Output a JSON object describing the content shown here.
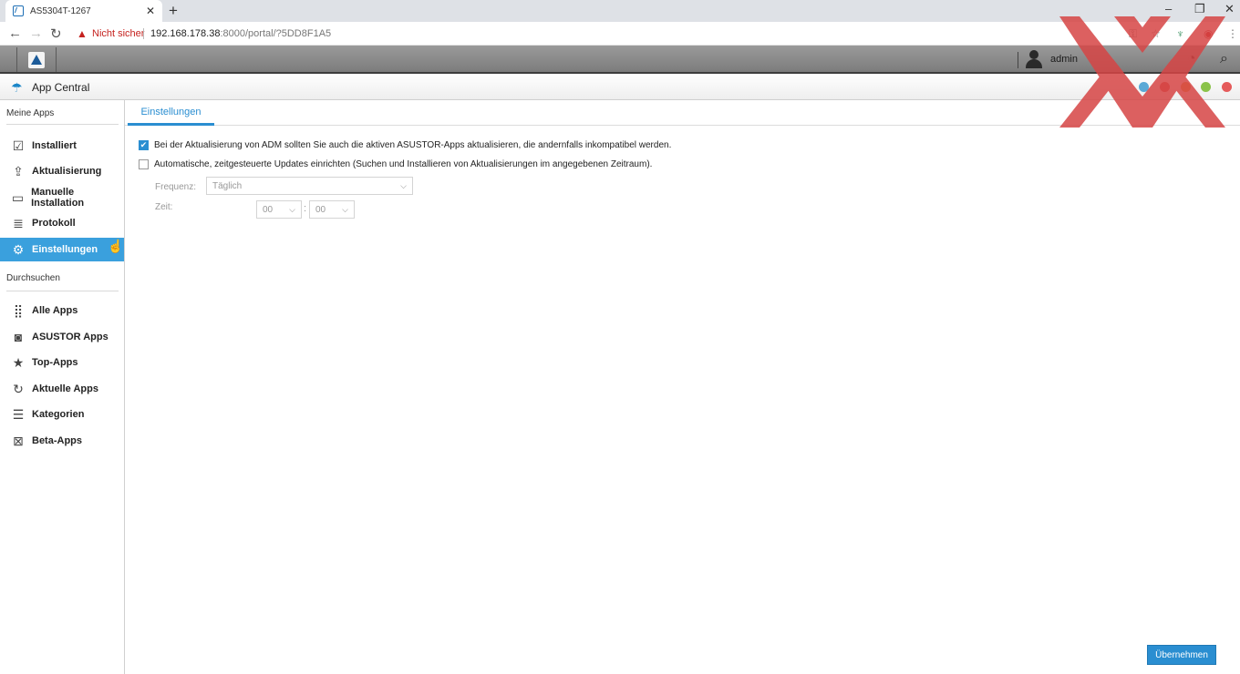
{
  "browser": {
    "tab_title": "AS5304T-1267",
    "tab_close": "✕",
    "new_tab": "+",
    "window_controls": [
      "–",
      "❐",
      "✕"
    ],
    "security_label": "Nicht sicher",
    "url_host": "192.168.178.38",
    "url_rest": ":8000/portal/?5DD8F1A5"
  },
  "topbar": {
    "user_name": "admin"
  },
  "app": {
    "title": "App Central",
    "window_dots": [
      "#5aa9d6",
      "#d9534f",
      "#e8a13a",
      "#8bc34a",
      "#e55b5b"
    ]
  },
  "sidebar": {
    "section_my_apps": "Meine Apps",
    "section_browse": "Durchsuchen",
    "my_apps": [
      {
        "label": "Installiert",
        "icon": "installed-icon"
      },
      {
        "label": "Aktualisierung",
        "icon": "update-icon"
      },
      {
        "label": "Manuelle Installation",
        "icon": "folder-icon"
      },
      {
        "label": "Protokoll",
        "icon": "log-icon"
      },
      {
        "label": "Einstellungen",
        "icon": "gear-icon",
        "active": true
      }
    ],
    "browse": [
      {
        "label": "Alle Apps",
        "icon": "grid-icon"
      },
      {
        "label": "ASUSTOR Apps",
        "icon": "asustor-icon"
      },
      {
        "label": "Top-Apps",
        "icon": "star-icon"
      },
      {
        "label": "Aktuelle Apps",
        "icon": "recent-icon"
      },
      {
        "label": "Kategorien",
        "icon": "list-icon"
      },
      {
        "label": "Beta-Apps",
        "icon": "beta-icon"
      }
    ]
  },
  "main": {
    "tab_label": "Einstellungen",
    "option1": "Bei der Aktualisierung von ADM sollten Sie auch die aktiven ASUSTOR-Apps aktualisieren, die andernfalls inkompatibel werden.",
    "option1_checked": true,
    "option2": "Automatische, zeitgesteuerte Updates einrichten (Suchen und Installieren von Aktualisierungen im angegebenen Zeitraum).",
    "option2_checked": false,
    "frequency_label": "Frequenz:",
    "frequency_value": "Täglich",
    "time_label": "Zeit:",
    "hour_value": "00",
    "minute_value": "00",
    "time_separator": ":",
    "apply_label": "Übernehmen"
  }
}
